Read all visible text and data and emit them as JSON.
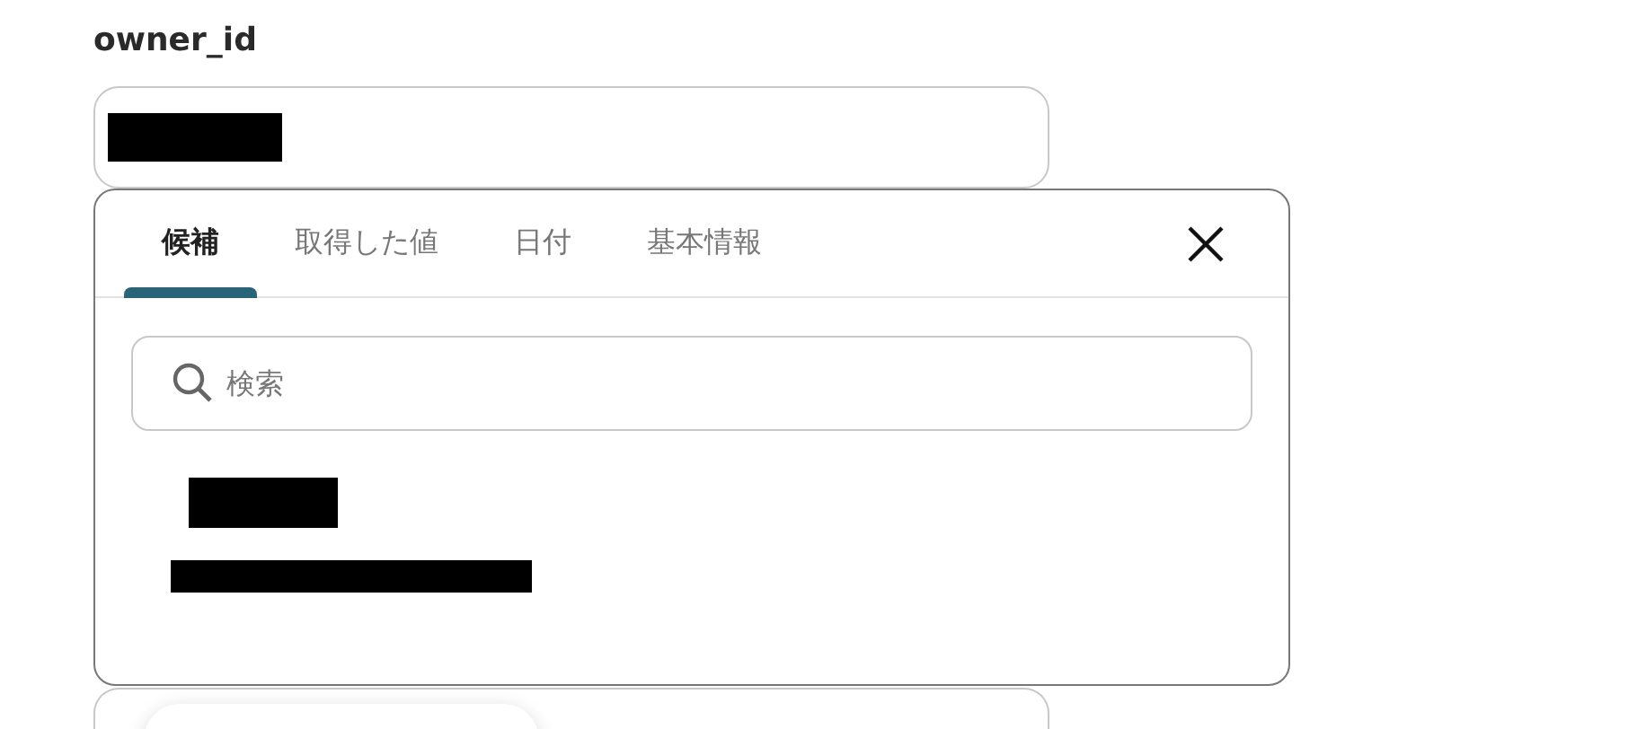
{
  "field": {
    "label": "owner_id"
  },
  "popup": {
    "tabs": [
      {
        "label": "候補",
        "selected": true
      },
      {
        "label": "取得した値",
        "selected": false
      },
      {
        "label": "日付",
        "selected": false
      },
      {
        "label": "基本情報",
        "selected": false
      }
    ],
    "search": {
      "placeholder": "検索"
    }
  }
}
